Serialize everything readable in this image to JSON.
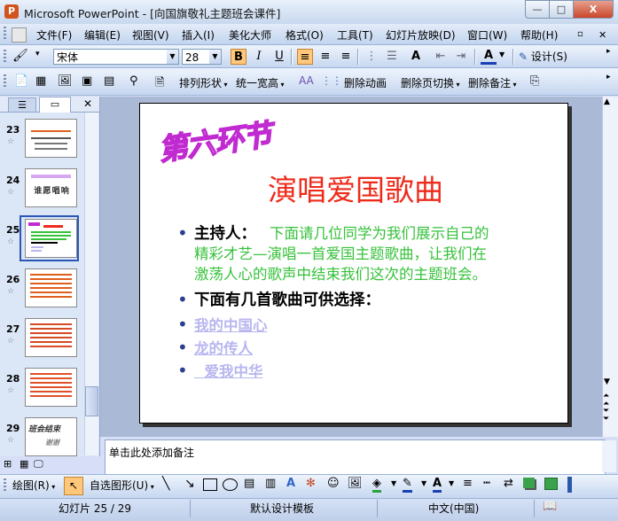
{
  "window": {
    "title": "Microsoft PowerPoint - [向国旗敬礼主题班会课件]",
    "app_icon_letter": "P",
    "min": "—",
    "max": "□",
    "close": "X"
  },
  "menu": [
    "文件(F)",
    "编辑(E)",
    "视图(V)",
    "插入(I)",
    "美化大师",
    "格式(O)",
    "工具(T)",
    "幻灯片放映(D)",
    "窗口(W)",
    "帮助(H)"
  ],
  "format_toolbar": {
    "font": "宋体",
    "size": "28",
    "bold": "B",
    "italic": "I",
    "underline": "U",
    "font_color": "A",
    "design": "设计(S)"
  },
  "custom_toolbar": [
    "排列形状",
    "统一宽高",
    "删除动画",
    "删除页切换",
    "删除备注"
  ],
  "slides_pane": {
    "items": [
      {
        "num": "23"
      },
      {
        "num": "24"
      },
      {
        "num": "25"
      },
      {
        "num": "26"
      },
      {
        "num": "27"
      },
      {
        "num": "28"
      },
      {
        "num": "29"
      }
    ],
    "selected": "25",
    "thumb24_text": "谁 愿 唱 响",
    "thumb29_top": "班会结束",
    "thumb29_bottom": "谢谢"
  },
  "slide": {
    "section_title": "第六环节",
    "heading": "演唱爱国歌曲",
    "bullet1_label": "主持人：",
    "bullet1_text_line1": "下面请几位同学为我们展示自己的",
    "bullet1_text_line2": "精彩才艺—演唱一首爱国主题歌曲，让我们在",
    "bullet1_text_line3": "激荡人心的歌声中结束我们这次的主题班会。",
    "bullet2": "下面有几首歌曲可供选择：",
    "songs": [
      "我的中国心",
      "龙的传人",
      "  爱我中华"
    ],
    "colors": {
      "section_title": "#c02ad0",
      "heading": "#ee2b1b",
      "green_text": "#36c23a",
      "link": "#b8b6ef",
      "bullet_dot": "#2d3e90"
    }
  },
  "notes": {
    "placeholder": "单击此处添加备注"
  },
  "draw_toolbar": {
    "draw": "绘图(R)",
    "autoshape": "自选图形(U)"
  },
  "status": {
    "slide": "幻灯片 25 / 29",
    "template": "默认设计模板",
    "language": "中文(中国)"
  }
}
